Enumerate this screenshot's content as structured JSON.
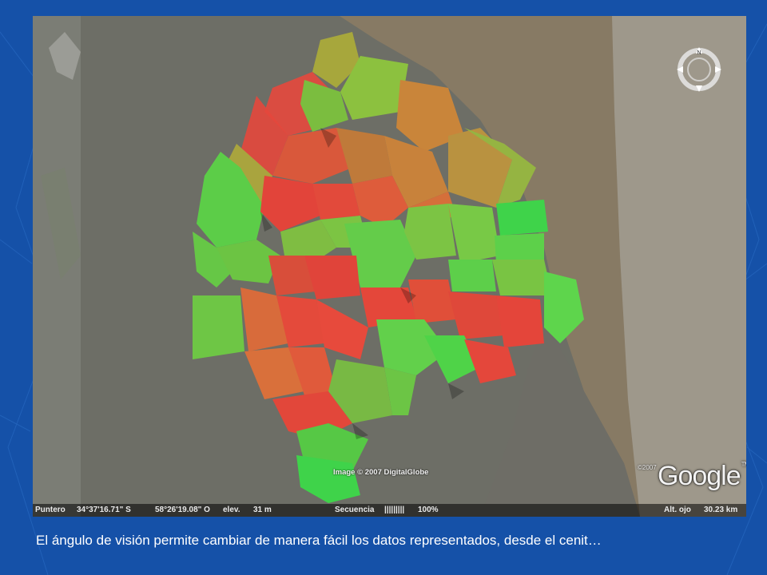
{
  "map": {
    "imagery_credit": "Image © 2007 DigitalGlobe",
    "logo_copyright": "©2007",
    "logo_text": "Google",
    "logo_tm": "TM",
    "compass_label": "N"
  },
  "status_bar": {
    "pointer_label": "Puntero",
    "pointer_lat": "34°37'16.71\" S",
    "pointer_lon": "58°26'19.08\" O",
    "elevation_label": "elev.",
    "elevation_value": "31 m",
    "streaming_label": "Secuencia",
    "streaming_bars": "|||||||||",
    "streaming_percent": "100%",
    "eye_alt_label": "Alt. ojo",
    "eye_alt_value": "30.23 km"
  },
  "caption": "El ángulo de visión permite cambiar de manera fácil los datos representados, desde el cenit…",
  "colors": {
    "slide_background": "#1551a8",
    "high": "#e6453a",
    "mid_high": "#d66a35",
    "mid": "#b98a38",
    "mid_low": "#8fae3a",
    "low": "#3fd34a",
    "river": "#877a64"
  }
}
